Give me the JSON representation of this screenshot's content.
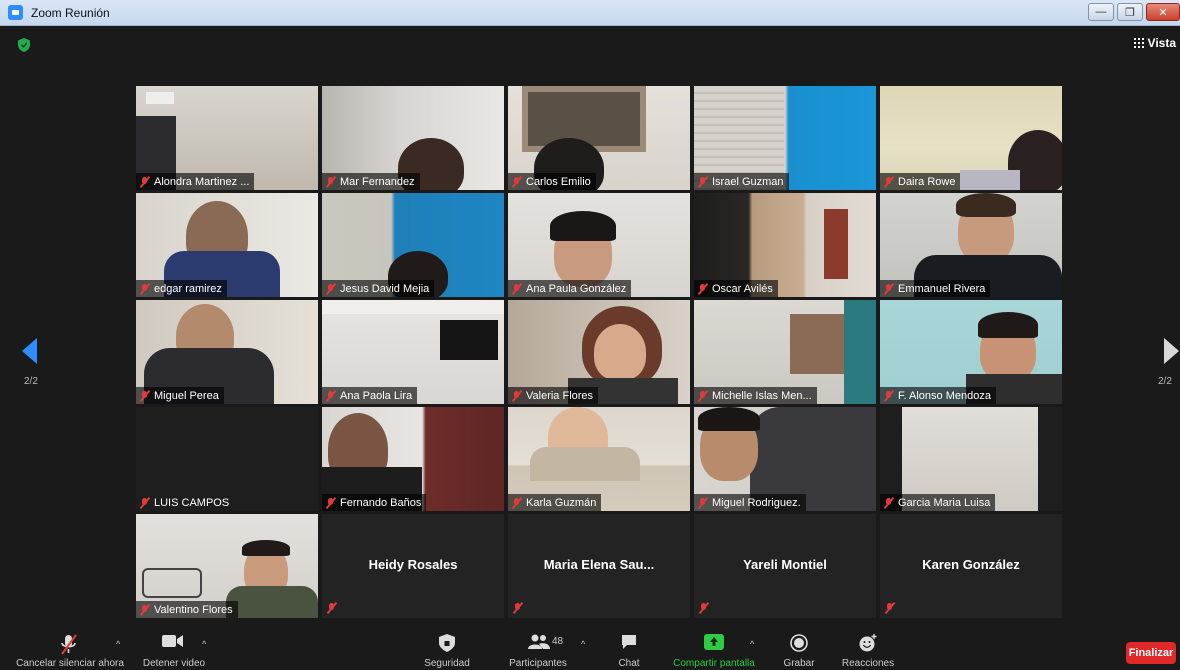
{
  "window": {
    "title": "Zoom Reunión"
  },
  "view_label": "Vista",
  "pagination": {
    "left": "2/2",
    "right": "2/2"
  },
  "participants": [
    {
      "name": "Alondra Martinez ...",
      "video": true
    },
    {
      "name": "Mar Fernandez",
      "video": true
    },
    {
      "name": "Carlos Emilio",
      "video": true
    },
    {
      "name": "Israel Guzman",
      "video": true
    },
    {
      "name": "Daira Rowe",
      "video": true
    },
    {
      "name": "edgar ramirez",
      "video": true
    },
    {
      "name": "Jesus David Mejia",
      "video": true
    },
    {
      "name": "Ana Paula González",
      "video": true
    },
    {
      "name": "Oscar Avilés",
      "video": true
    },
    {
      "name": "Emmanuel Rivera",
      "video": true
    },
    {
      "name": "Miguel Perea",
      "video": true
    },
    {
      "name": "Ana Paola Lira",
      "video": true
    },
    {
      "name": "Valeria Flores",
      "video": true
    },
    {
      "name": "Michelle Islas Men...",
      "video": true
    },
    {
      "name": "F. Alonso Mendoza",
      "video": true
    },
    {
      "name": "LUIS CAMPOS",
      "video": false
    },
    {
      "name": "Fernando Baños",
      "video": true
    },
    {
      "name": "Karla Guzmán",
      "video": true
    },
    {
      "name": "Miguel Rodriguez.",
      "video": true
    },
    {
      "name": "Garcia Maria Luisa",
      "video": true
    },
    {
      "name": "Valentino Flores",
      "video": true
    },
    {
      "name": "Heidy Rosales",
      "video": false
    },
    {
      "name": "Maria Elena Sau...",
      "video": false
    },
    {
      "name": "Yareli Montiel",
      "video": false
    },
    {
      "name": "Karen González",
      "video": false
    }
  ],
  "toolbar": {
    "unmute_label": "Cancelar silenciar ahora",
    "stop_video_label": "Detener video",
    "security_label": "Seguridad",
    "participants_label": "Participantes",
    "participants_count": "48",
    "chat_label": "Chat",
    "share_label": "Compartir pantalla",
    "record_label": "Grabar",
    "reactions_label": "Reacciones",
    "end_label": "Finalizar"
  },
  "colors": {
    "mic_off": "#e03a3a",
    "share_green": "#2ecc40",
    "end_red": "#e02828",
    "accent_blue": "#2d8cff"
  }
}
